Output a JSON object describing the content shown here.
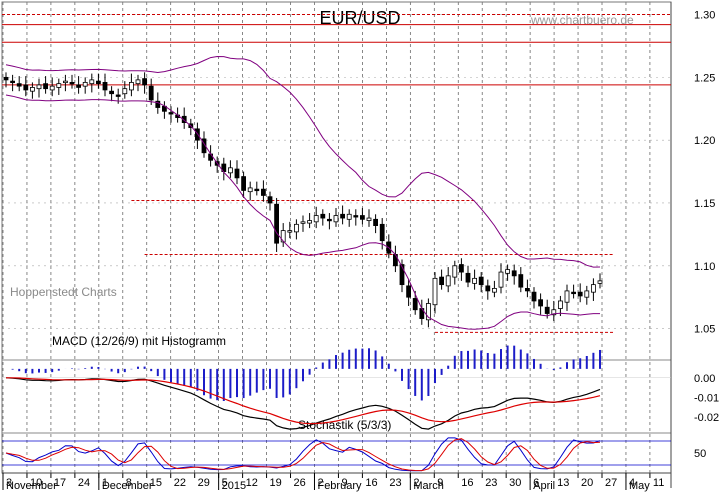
{
  "chart_data": {
    "type": "candlestick",
    "title": "EUR/USD",
    "watermark": "www.chartbuero.de",
    "source_label": "Hoppenstedt Charts",
    "price_axis": {
      "ticks": [
        "1.30",
        "1.25",
        "1.20",
        "1.15",
        "1.10",
        "1.05"
      ],
      "ylim": [
        1.025,
        1.31
      ]
    },
    "macd_axis": {
      "ticks": [
        "0.00",
        "-0.01",
        "-0.02"
      ],
      "ylim": [
        -0.028,
        0.009
      ]
    },
    "stoch_axis": {
      "ticks": [
        "50"
      ],
      "ylim": [
        0,
        100
      ]
    },
    "macd_label": "MACD (12/26/9) mit Histogramm",
    "stoch_label": "Stochastik (5/3/3)",
    "x_day_labels": [
      "3",
      "10",
      "17",
      "24",
      "1",
      "8",
      "15",
      "22",
      "29",
      "5",
      "12",
      "19",
      "26",
      "2",
      "9",
      "16",
      "23",
      "2",
      "9",
      "16",
      "23",
      "30",
      "6",
      "13",
      "20",
      "27",
      "4",
      "11"
    ],
    "x_month_labels": [
      "November",
      "December",
      "2015",
      "February",
      "March",
      "April",
      "May"
    ],
    "resistance_lines": [
      1.3,
      1.292,
      1.278,
      1.244
    ],
    "range_lines": [
      {
        "y": 1.152,
        "from": 19,
        "to": 71
      },
      {
        "y": 1.109,
        "from": 21,
        "to": 92
      },
      {
        "y": 1.047,
        "from": 65,
        "to": 92
      }
    ],
    "stoch_levels": [
      80,
      20
    ],
    "colors": {
      "resistance": "#cc0000",
      "bollinger": "#800080",
      "macd_line": "#000000",
      "signal_line": "#dd0000",
      "histogram": "#1c1cc8",
      "stoch_k": "#0000cc",
      "stoch_d": "#dd0000",
      "grid": "#555555"
    },
    "closes": [
      1.248,
      1.246,
      1.243,
      1.24,
      1.242,
      1.244,
      1.241,
      1.243,
      1.245,
      1.247,
      1.245,
      1.242,
      1.246,
      1.248,
      1.245,
      1.24,
      1.237,
      1.236,
      1.241,
      1.246,
      1.248,
      1.244,
      1.232,
      1.226,
      1.223,
      1.221,
      1.218,
      1.214,
      1.21,
      1.2,
      1.19,
      1.184,
      1.18,
      1.175,
      1.178,
      1.17,
      1.16,
      1.162,
      1.16,
      1.156,
      1.15,
      1.118,
      1.128,
      1.128,
      1.133,
      1.135,
      1.136,
      1.14,
      1.138,
      1.136,
      1.14,
      1.138,
      1.141,
      1.139,
      1.137,
      1.138,
      1.132,
      1.12,
      1.11,
      1.1,
      1.085,
      1.075,
      1.065,
      1.058,
      1.07,
      1.09,
      1.085,
      1.092,
      1.1,
      1.095,
      1.087,
      1.09,
      1.085,
      1.08,
      1.082,
      1.095,
      1.097,
      1.092,
      1.083,
      1.08,
      1.072,
      1.068,
      1.062,
      1.065,
      1.072,
      1.08,
      1.078,
      1.076,
      1.08,
      1.085,
      1.088
    ]
  }
}
